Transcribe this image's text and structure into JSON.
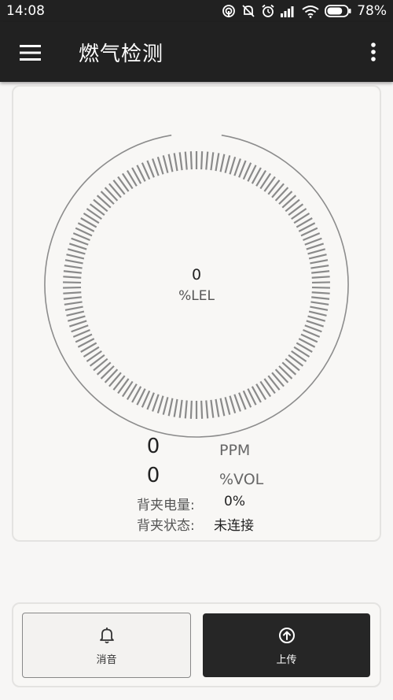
{
  "status_bar": {
    "time": "14:08",
    "battery_percent": "78%",
    "battery_level": 78,
    "icons": [
      "hotspot-icon",
      "mute-alarm-icon",
      "alarm-clock-icon",
      "signal-icon",
      "wifi-icon",
      "battery-icon"
    ]
  },
  "app_bar": {
    "title": "燃气检测",
    "menu_icon": "hamburger-menu-icon",
    "more_icon": "more-vertical-icon"
  },
  "gauge": {
    "value": "0",
    "unit": "%LEL",
    "level": 0
  },
  "readings": [
    {
      "value": "0",
      "unit": "PPM"
    },
    {
      "value": "0",
      "unit": "%VOL"
    }
  ],
  "info": [
    {
      "label": "背夹电量:",
      "value": "0%"
    },
    {
      "label": "背夹状态:",
      "value": "未连接"
    }
  ],
  "actions": {
    "mute": {
      "label": "消音",
      "icon": "bell-icon"
    },
    "upload": {
      "label": "上传",
      "icon": "upload-circle-icon"
    }
  },
  "colors": {
    "bar_background": "#212121",
    "page_background": "#f7f6f5",
    "tick_color": "#8a8a8a",
    "upload_button": "#262626"
  }
}
